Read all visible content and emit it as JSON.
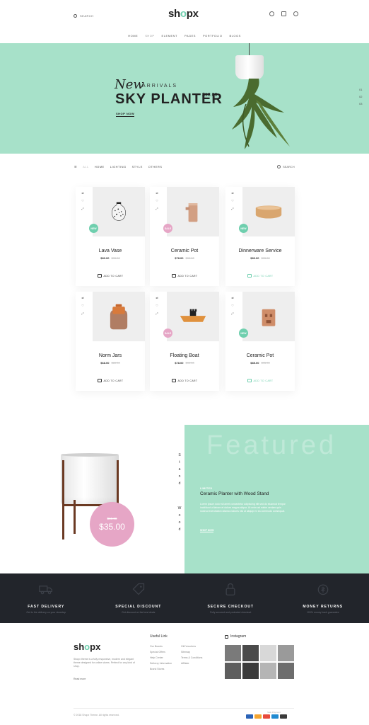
{
  "header": {
    "search_label": "SEARCH",
    "logo_prefix": "sh",
    "logo_o": "o",
    "logo_suffix": "px",
    "nav": [
      "HOME",
      "SHOP",
      "ELEMENT",
      "PAGES",
      "PORTFOLIO",
      "BLOGS"
    ],
    "nav_active_index": 1,
    "icons": [
      "user-icon",
      "cart-icon",
      "menu-icon"
    ]
  },
  "hero": {
    "new": "New",
    "arrivals": "ARRIVALS",
    "title": "SKY PLANTER",
    "price": "$18.00",
    "button": "SHOP NOW",
    "slides": [
      "01",
      "02",
      "03"
    ],
    "background": "#a7e1c9"
  },
  "filter": {
    "items": [
      "ALL",
      "HOME",
      "LIGHTING",
      "STYLE",
      "OTHERS"
    ],
    "search_label": "SEARCH"
  },
  "products": [
    {
      "name": "Lava Vase",
      "price": "$80.00",
      "old_price": "$95.00",
      "badge": "NEW",
      "badge_color": "#6fcfae",
      "cart": "ADD TO CART",
      "cart_highlight": false
    },
    {
      "name": "Ceramic Pot",
      "price": "$78.00",
      "old_price": "$90.00",
      "badge": "SALE",
      "badge_color": "#e6a6c6",
      "cart": "ADD TO CART",
      "cart_highlight": false
    },
    {
      "name": "Dinnerware Service",
      "price": "$80.00",
      "old_price": "$95.00",
      "badge": "NEW",
      "badge_color": "#6fcfae",
      "cart": "ADD TO CART",
      "cart_highlight": true
    },
    {
      "name": "Norm Jars",
      "price": "$68.00",
      "old_price": "$80.00",
      "badge": "",
      "badge_color": "",
      "cart": "ADD TO CART",
      "cart_highlight": false
    },
    {
      "name": "Floating Boat",
      "price": "$78.00",
      "old_price": "$90.00",
      "badge": "SALE",
      "badge_color": "#e6a6c6",
      "cart": "ADD TO CART",
      "cart_highlight": false
    },
    {
      "name": "Ceramic Pot",
      "price": "$85.00",
      "old_price": "$95.00",
      "badge": "NEW",
      "badge_color": "#6fcfae",
      "cart": "ADD TO CART",
      "cart_highlight": true
    }
  ],
  "featured": {
    "watermark": "Featured",
    "vertical_text": "Stand",
    "vertical_text_2": "Wood",
    "new_label": "LIMITED",
    "title": "Ceramic Planter with Wood Stand",
    "description": "Lorem ipsum dolor sit amet consectetur adipiscing elit sed do eiusmod tempor incididunt ut labore et dolore magna aliqua. Ut enim ad minim veniam quis nostrud exercitation ullamco laboris nisi ut aliquip ex ea commodo consequat.",
    "link": "SHOP NOW",
    "old_price": "$50.00",
    "price": "$35.00"
  },
  "features": [
    {
      "icon": "truck-icon",
      "title": "FAST DELIVERY",
      "desc": "Get to the delivery on your doorstep"
    },
    {
      "icon": "tag-icon",
      "title": "SPECIAL DISCOUNT",
      "desc": "Get discount on the best deals"
    },
    {
      "icon": "lock-icon",
      "title": "SECURE CHECKOUT",
      "desc": "Fully secured and protected checkout"
    },
    {
      "icon": "money-icon",
      "title": "MONEY RETURNS",
      "desc": "100% money back guarantee"
    }
  ],
  "footer": {
    "about": "Shopx theme is a fully responsive, modern and elegant theme designed for online stores. Perfect for any kind of shop.",
    "read_more": "Read more",
    "useful_heading": "Useful Link",
    "links_col1": [
      "Our Brands",
      "Special Offers",
      "Help Center",
      "Delivery Information",
      "Brand Stores"
    ],
    "links_col2": [
      "Gift Vouchers",
      "Sitemap",
      "Terms & Conditions",
      "Affiliate"
    ],
    "instagram_heading": "Instagram",
    "copyright": "© 2018 Shopx Theme. All rights reserved.",
    "payments_label": "Safe Payment",
    "payment_colors": [
      "#2b63b7",
      "#f4a531",
      "#e84a3c",
      "#1f8ad1",
      "#3b3b3b"
    ]
  }
}
